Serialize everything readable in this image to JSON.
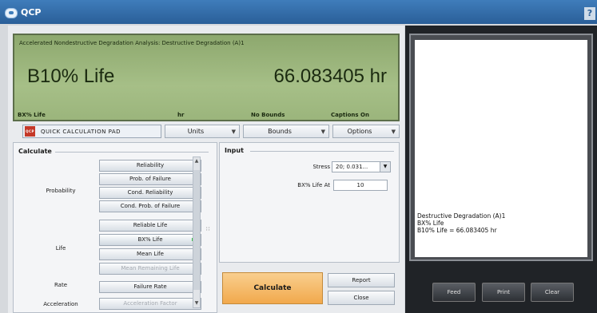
{
  "window": {
    "title": "QCP",
    "help_label": "?"
  },
  "display": {
    "subtitle": "Accelerated Nondestructive Degradation Analysis: Destructive Degradation (A)1",
    "result_label": "B10% Life",
    "result_value": "66.083405 hr",
    "footer": [
      "BX% Life",
      "hr",
      "No Bounds",
      "Captions On"
    ]
  },
  "toolbar": {
    "quick_calc_label": "Quick Calculation Pad",
    "quick_calc_icon_text": "QCP",
    "units_label": "Units",
    "bounds_label": "Bounds",
    "options_label": "Options"
  },
  "calculate": {
    "header": "Calculate",
    "categories": {
      "probability": "Probability",
      "life": "Life",
      "rate": "Rate",
      "acceleration": "Acceleration"
    },
    "buttons": {
      "reliability": "Reliability",
      "prob_failure": "Prob. of Failure",
      "cond_reliability": "Cond. Reliability",
      "cond_prob_failure": "Cond. Prob. of Failure",
      "reliable_life": "Reliable Life",
      "bx_life": "BX% Life",
      "mean_life": "Mean Life",
      "mean_remaining_life": "Mean Remaining Life",
      "failure_rate": "Failure Rate",
      "acceleration_factor": "Acceleration Factor"
    }
  },
  "input": {
    "header": "Input",
    "stress_label": "Stress",
    "stress_value": "20; 0.031...",
    "bx_label": "BX% Life At",
    "bx_value": "10"
  },
  "actions": {
    "calculate": "Calculate",
    "report": "Report",
    "close": "Close"
  },
  "output": {
    "text": "Destructive Degradation (A)1\nBX% Life\nB10% Life = 66.083405 hr"
  },
  "printer": {
    "feed": "Feed",
    "print": "Print",
    "clear": "Clear"
  }
}
